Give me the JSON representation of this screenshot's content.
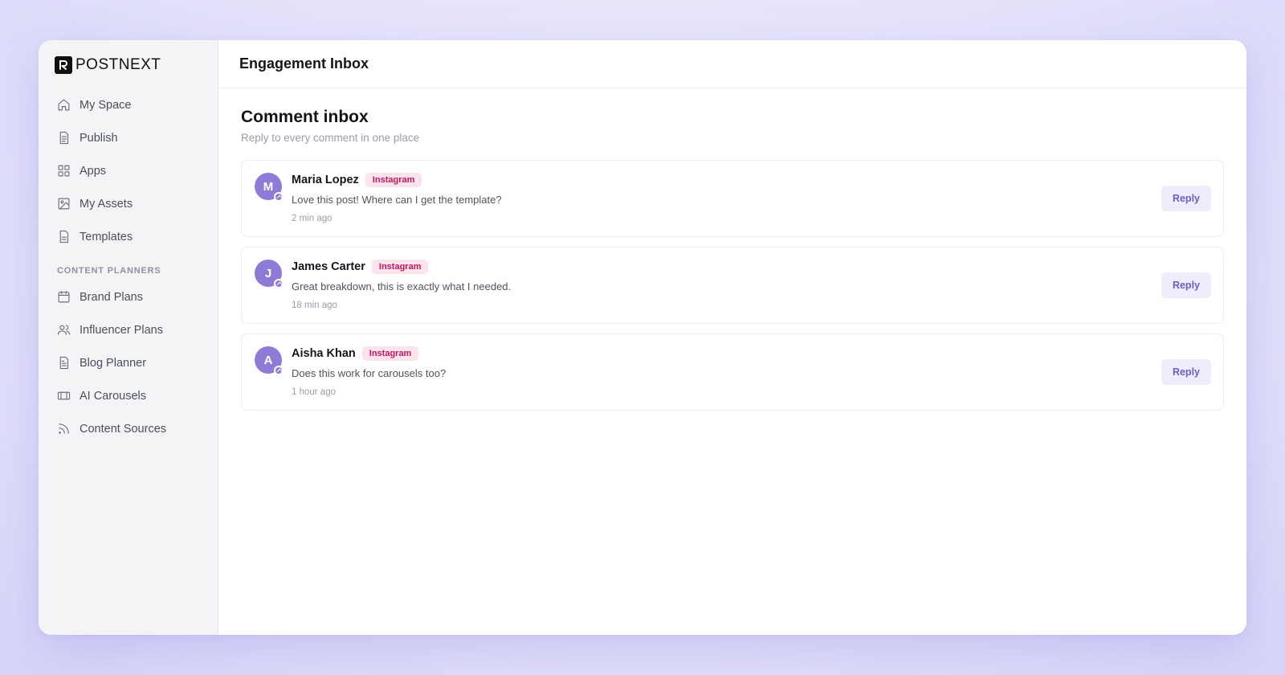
{
  "app": {
    "brand": "POSTNEXT",
    "window_title": "Engagement Inbox"
  },
  "sidebar": {
    "items": [
      {
        "label": "My Space",
        "icon": "home-icon"
      },
      {
        "label": "Publish",
        "icon": "document-icon"
      },
      {
        "label": "Apps",
        "icon": "grid-icon"
      },
      {
        "label": "My Assets",
        "icon": "image-icon"
      },
      {
        "label": "Templates",
        "icon": "file-icon"
      }
    ],
    "section_label": "CONTENT PLANNERS",
    "planner_items": [
      {
        "label": "Brand Plans",
        "icon": "calendar-icon"
      },
      {
        "label": "Influencer Plans",
        "icon": "users-icon"
      },
      {
        "label": "Blog Planner",
        "icon": "file-text-icon"
      },
      {
        "label": "AI Carousels",
        "icon": "carousel-icon"
      },
      {
        "label": "Content Sources",
        "icon": "rss-icon"
      }
    ]
  },
  "main": {
    "title": "Comment inbox",
    "subtitle": "Reply to every comment in one place",
    "comments": [
      {
        "initial": "M",
        "name": "Maria Lopez",
        "platform": "Instagram",
        "text": "Love this post! Where can I get the template?",
        "time": "2 min ago",
        "action": "Reply"
      },
      {
        "initial": "J",
        "name": "James Carter",
        "platform": "Instagram",
        "text": "Great breakdown, this is exactly what I needed.",
        "time": "18 min ago",
        "action": "Reply"
      },
      {
        "initial": "A",
        "name": "Aisha Khan",
        "platform": "Instagram",
        "text": "Does this work for carousels too?",
        "time": "1 hour ago",
        "action": "Reply"
      }
    ]
  },
  "colors": {
    "accent": "#8f7ad8",
    "badge_text": "#c2185b",
    "badge_bg": "#fde3ee",
    "reply_text": "#6d5fc6",
    "reply_bg": "#eeedfb"
  }
}
